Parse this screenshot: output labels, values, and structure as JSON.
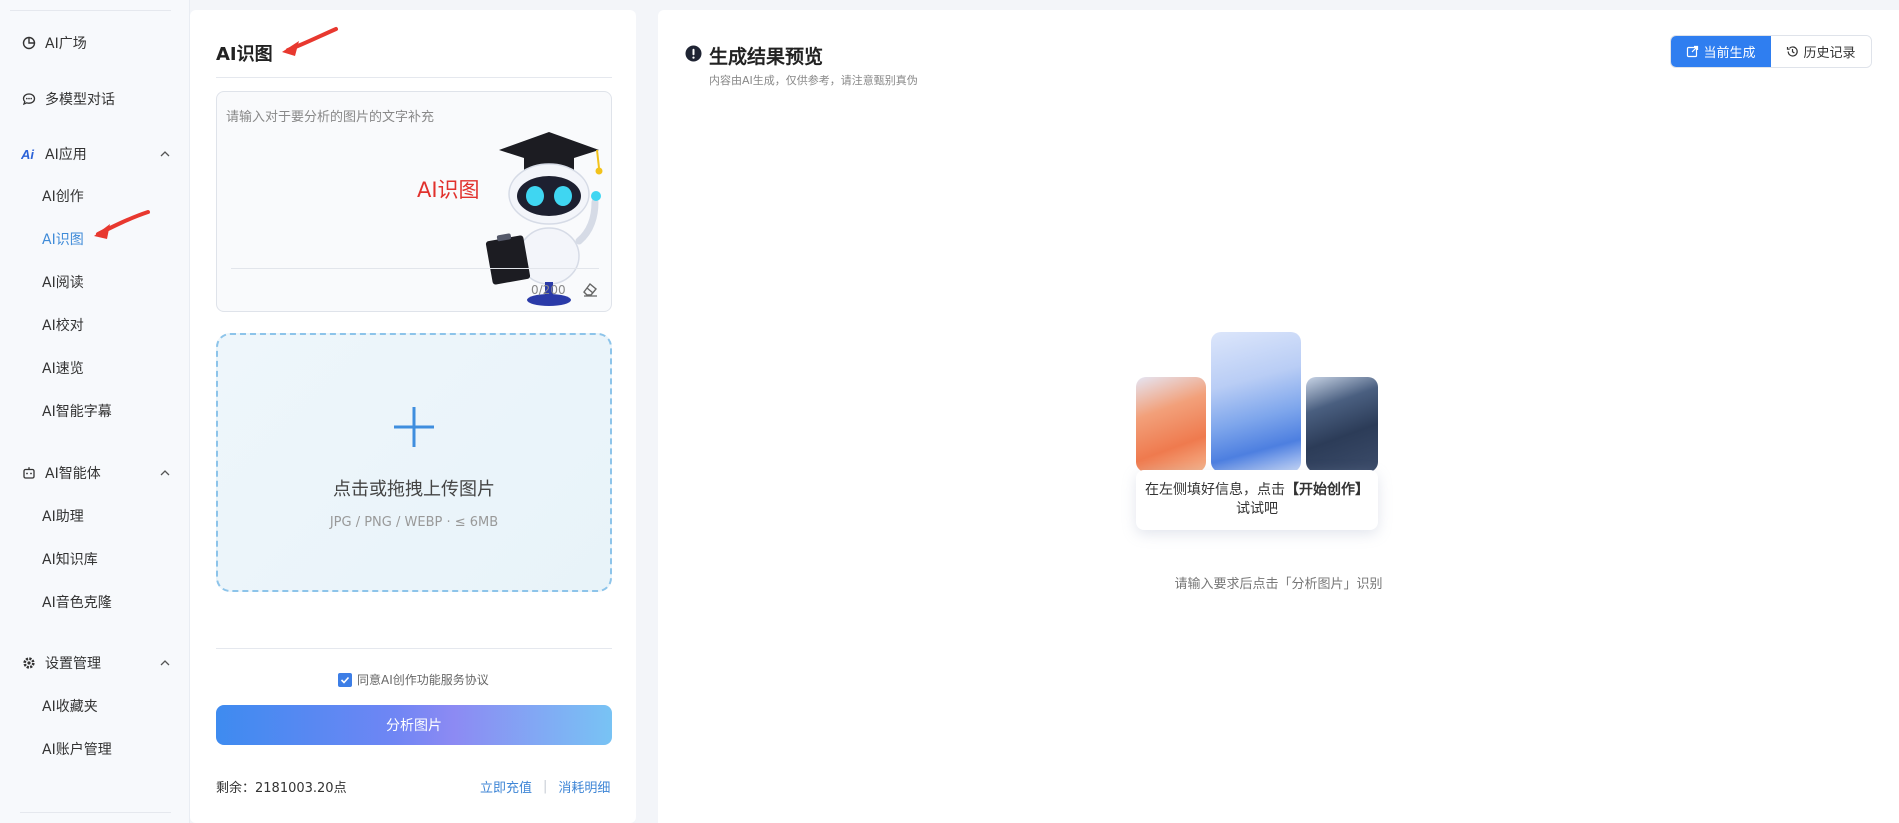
{
  "sidebar": {
    "groups": [
      {
        "label": "AI广场"
      },
      {
        "label": "多模型对话"
      },
      {
        "label": "AI应用",
        "items": [
          "AI创作",
          "AI识图",
          "AI阅读",
          "AI校对",
          "AI速览",
          "AI智能字幕"
        ]
      },
      {
        "label": "AI智能体",
        "items": [
          "AI助理",
          "AI知识库",
          "AI音色克隆"
        ]
      },
      {
        "label": "设置管理",
        "items": [
          "AI收藏夹",
          "AI账户管理"
        ]
      }
    ],
    "active_item": "AI识图"
  },
  "panel": {
    "title": "AI识图",
    "textarea_placeholder": "请输入对于要分析的图片的文字补充",
    "banner_text": "AI识图",
    "char_count": "0/200",
    "upload_label": "点击或拖拽上传图片",
    "upload_hint": "JPG / PNG / WEBP · ≤ 6MB",
    "agree_label": "同意AI创作功能服务协议",
    "agree_checked": true,
    "analyze_button": "分析图片",
    "balance": "剩余：2181003.20点",
    "recharge_link": "立即充值",
    "detail_link": "消耗明细"
  },
  "result": {
    "title": "生成结果预览",
    "subtitle": "内容由AI生成，仅供参考，请注意甄别真伪",
    "tab_current": "当前生成",
    "tab_history": "历史记录",
    "tip_prefix": "在左侧填好信息，点击",
    "tip_action": "【开始创作】",
    "tip_suffix": "试试吧",
    "hint": "请输入要求后点击「分析图片」识别"
  },
  "colors": {
    "accent": "#2f7ef0",
    "active_nav": "#3f8bd8",
    "banner_red": "#e1312d",
    "annotation_arrow": "#e8382f"
  }
}
